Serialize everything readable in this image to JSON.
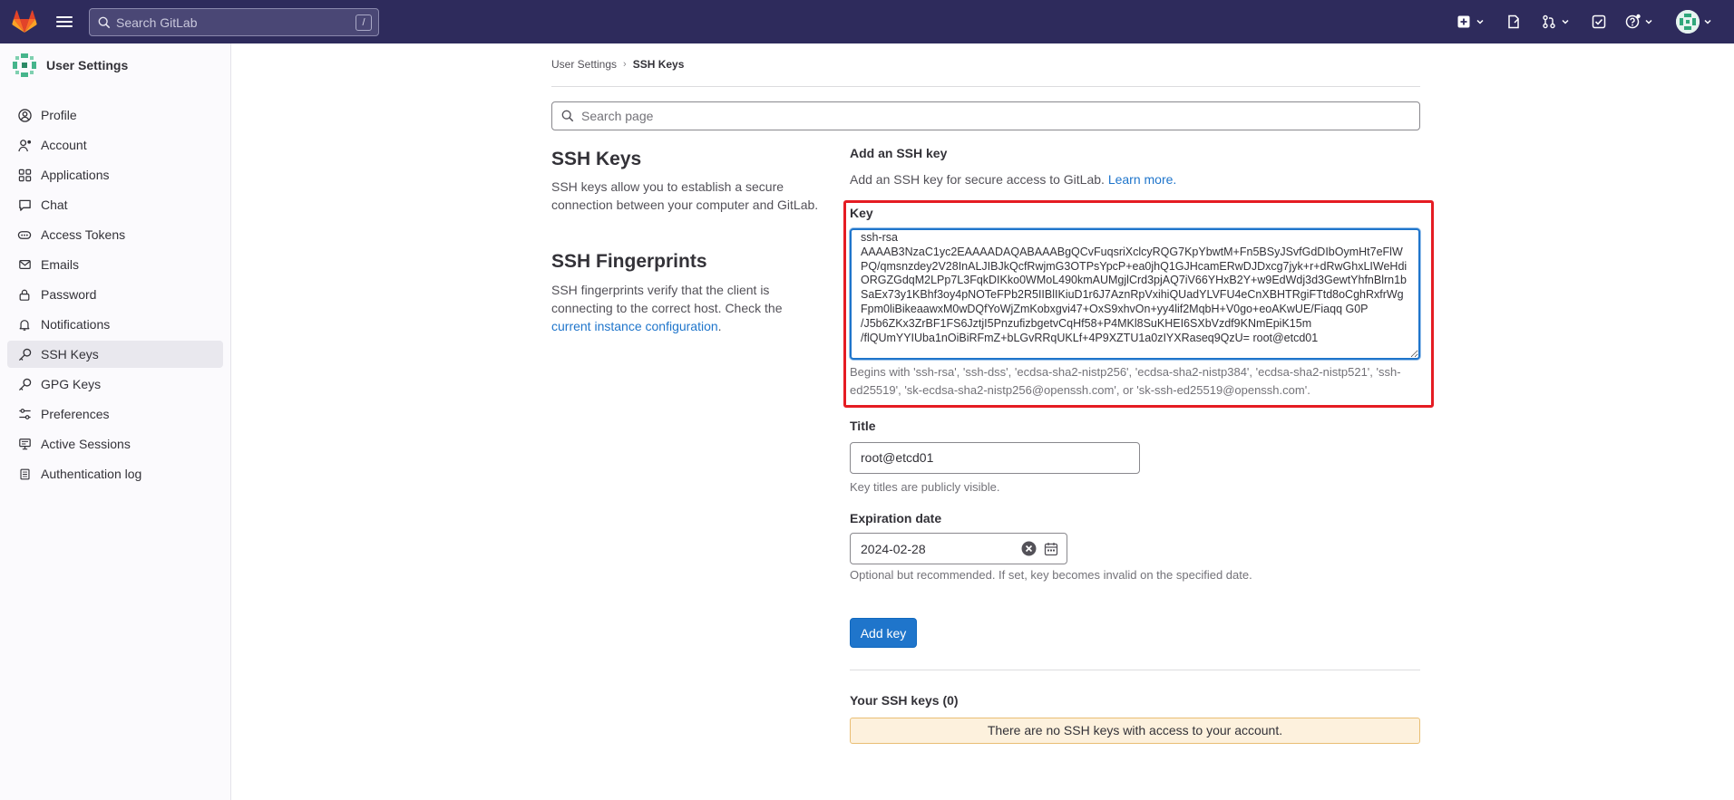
{
  "topbar": {
    "search_placeholder": "Search GitLab",
    "search_shortcut": "/"
  },
  "sidebar": {
    "title": "User Settings",
    "items": [
      {
        "label": "Profile",
        "icon": "profile-icon"
      },
      {
        "label": "Account",
        "icon": "account-icon"
      },
      {
        "label": "Applications",
        "icon": "applications-icon"
      },
      {
        "label": "Chat",
        "icon": "chat-icon"
      },
      {
        "label": "Access Tokens",
        "icon": "token-icon"
      },
      {
        "label": "Emails",
        "icon": "mail-icon"
      },
      {
        "label": "Password",
        "icon": "lock-icon"
      },
      {
        "label": "Notifications",
        "icon": "bell-icon"
      },
      {
        "label": "SSH Keys",
        "icon": "key-icon",
        "active": true
      },
      {
        "label": "GPG Keys",
        "icon": "key-icon"
      },
      {
        "label": "Preferences",
        "icon": "preferences-icon"
      },
      {
        "label": "Active Sessions",
        "icon": "monitor-icon"
      },
      {
        "label": "Authentication log",
        "icon": "log-icon"
      }
    ]
  },
  "breadcrumb": {
    "parent": "User Settings",
    "current": "SSH Keys"
  },
  "page_search_placeholder": "Search page",
  "ssh_keys_section": {
    "title": "SSH Keys",
    "description": "SSH keys allow you to establish a secure connection between your computer and GitLab."
  },
  "fingerprints_section": {
    "title": "SSH Fingerprints",
    "description_prefix": "SSH fingerprints verify that the client is connecting to the correct host. Check the ",
    "link_text": "current instance configuration",
    "description_suffix": "."
  },
  "form": {
    "heading": "Add an SSH key",
    "intro_text": "Add an SSH key for secure access to GitLab.",
    "learn_more": "Learn more.",
    "key_label": "Key",
    "key_value": "ssh-rsa\nAAAAB3NzaC1yc2EAAAADAQABAAABgQCvFuqsriXclcyRQG7KpYbwtM+Fn5BSyJSvfGdDIbOymHt7eFlWPQ/qmsnzdey2V28InALJIBJkQcfRwjmG3OTPsYpcP+ea0jhQ1GJHcamERwDJDxcg7jyk+r+dRwGhxLIWeHdiORGZGdqM2LPp7L3FqkDIKko0WMoL490kmAUMgjlCrd3pjAQ7iV66YHxB2Y+w9EdWdj3d3GewtYhfnBlrn1bSaEx73y1KBhf3oy4pNOTeFPb2R5IIBlIKiuD1r6J7AznRpVxihiQUadYLVFU4eCnXBHTRgiFTtd8oCghRxfrWgFpm0liBikeaawxM0wDQfYoWjZmKobxgvi47+OxS9xhvOn+yy4lif2MqbH+V0go+eoAKwUE/Fiaqq G0P\n/J5b6ZKx3ZrBF1FS6JztjI5PnzufizbgetvCqHf58+P4MKl8SuKHEI6SXbVzdf9KNmEpiK15m\n/flQUmYYIUba1nOiBiRFmZ+bLGvRRqUKLf+4P9XZTU1a0zIYXRaseq9QzU= root@etcd01",
    "key_help": "Begins with 'ssh-rsa', 'ssh-dss', 'ecdsa-sha2-nistp256', 'ecdsa-sha2-nistp384', 'ecdsa-sha2-nistp521', 'ssh-ed25519', 'sk-ecdsa-sha2-nistp256@openssh.com', or 'sk-ssh-ed25519@openssh.com'.",
    "title_label": "Title",
    "title_value": "root@etcd01",
    "title_help": "Key titles are publicly visible.",
    "expiration_label": "Expiration date",
    "expiration_value": "2024-02-28",
    "expiration_help": "Optional but recommended. If set, key becomes invalid on the specified date.",
    "submit_label": "Add key"
  },
  "your_keys": {
    "heading": "Your SSH keys (0)",
    "empty_message": "There are no SSH keys with access to your account."
  },
  "colors": {
    "topbar": "#2e2b5c",
    "primary": "#1f75cb",
    "highlight": "#e51c23",
    "notice_bg": "#fdf1dd"
  }
}
